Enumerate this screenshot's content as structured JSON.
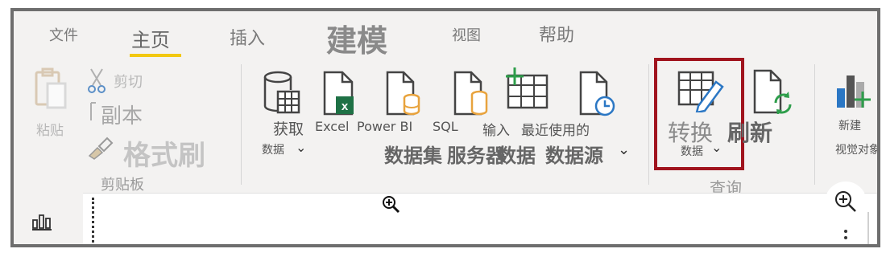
{
  "tabs": [
    {
      "label": "文件"
    },
    {
      "label": "主页"
    },
    {
      "label": "插入"
    },
    {
      "label": "建模"
    },
    {
      "label": "视图"
    },
    {
      "label": "帮助"
    }
  ],
  "clipboard": {
    "paste_label": "粘贴",
    "cut_label": "剪切",
    "copy_label": "副本",
    "format_painter_label": "格式刷",
    "group_label": "剪贴板"
  },
  "data_group": {
    "get_data_line1": "获取",
    "get_data_line2": "数据",
    "excel_label": "Excel",
    "powerbi_line1": "Power BI",
    "powerbi_line2": "数据集",
    "sql_line1": "SQL",
    "sql_line2": "服务器",
    "enter_data_line1": "输入",
    "enter_data_line2": "数据",
    "recent_line1": "最近使用的",
    "recent_line2": "数据源",
    "caret": "⌄"
  },
  "queries": {
    "transform_line1": "转换",
    "transform_line2": "数据",
    "refresh_label": "刷新",
    "group_label": "查询"
  },
  "insert": {
    "new_visual_line1": "新建",
    "new_visual_line2": "视觉对象"
  },
  "colors": {
    "accent_underline": "#f2c811",
    "highlight_border": "#a0141e",
    "excel_green": "#1e7145",
    "sql_orange": "#e8a33d",
    "refresh_green": "#2e9e4b",
    "visual_blue": "#2b77c4"
  }
}
